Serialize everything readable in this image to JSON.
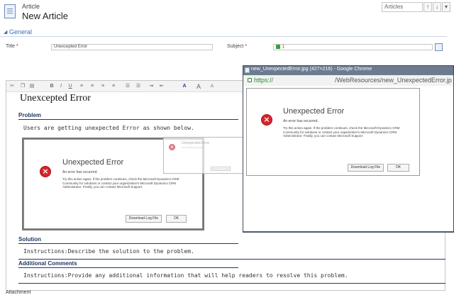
{
  "header": {
    "entity_label": "Article",
    "record_title": "New Article",
    "nav_select": "Articles",
    "nav_up": "↑",
    "nav_down": "↓",
    "nav_more": "▾"
  },
  "section": {
    "toggle": "◢",
    "title": "General"
  },
  "form": {
    "title_label": "Title",
    "title_value": "Unexcepted Error",
    "subject_label": "Subject",
    "subject_value": "1",
    "required_mark": "*"
  },
  "toolbar": {
    "bold": "B",
    "italic": "I",
    "underline": "U",
    "font_size_up": "A",
    "font_size_down": "A",
    "font_color": "A"
  },
  "article": {
    "heading": "Unexcepted Error",
    "sections": [
      {
        "title": "Problem",
        "text": "Users are getting unexpected Error as shown below."
      },
      {
        "title": "Solution",
        "text": "Instructions:Describe the solution to the problem."
      },
      {
        "title": "Additional Comments",
        "text": "Instructions:Provide any additional information that will help readers to resolve this problem."
      }
    ],
    "attachment_label": "Attachment"
  },
  "error_dialog": {
    "icon": "×",
    "title": "Unexpected Error",
    "subtitle": "An error has occurred.",
    "body": "Try this action again. If the problem continues, check the Microsoft Dynamics CRM Community for solutions or contact your organization's Microsoft Dynamics CRM Administrator. Finally, you can contact Microsoft Support.",
    "download_label": "Download Log File",
    "ok_label": "OK"
  },
  "drag_ghost": {
    "title": "Unexpected Error",
    "subtitle": "An error has occurred.",
    "button": "Download Log File"
  },
  "chrome": {
    "title": "new_UnexpectedError.jpg (427×216) - Google Chrome",
    "url_scheme": "https://",
    "url_host": "",
    "url_path": "/WebResources/new_UnexpectedError.jp"
  },
  "colors": {
    "accent": "#3b6fb6",
    "heading": "#1f3864",
    "error": "#d9232d",
    "chrome_frame": "#5b6a7e"
  }
}
